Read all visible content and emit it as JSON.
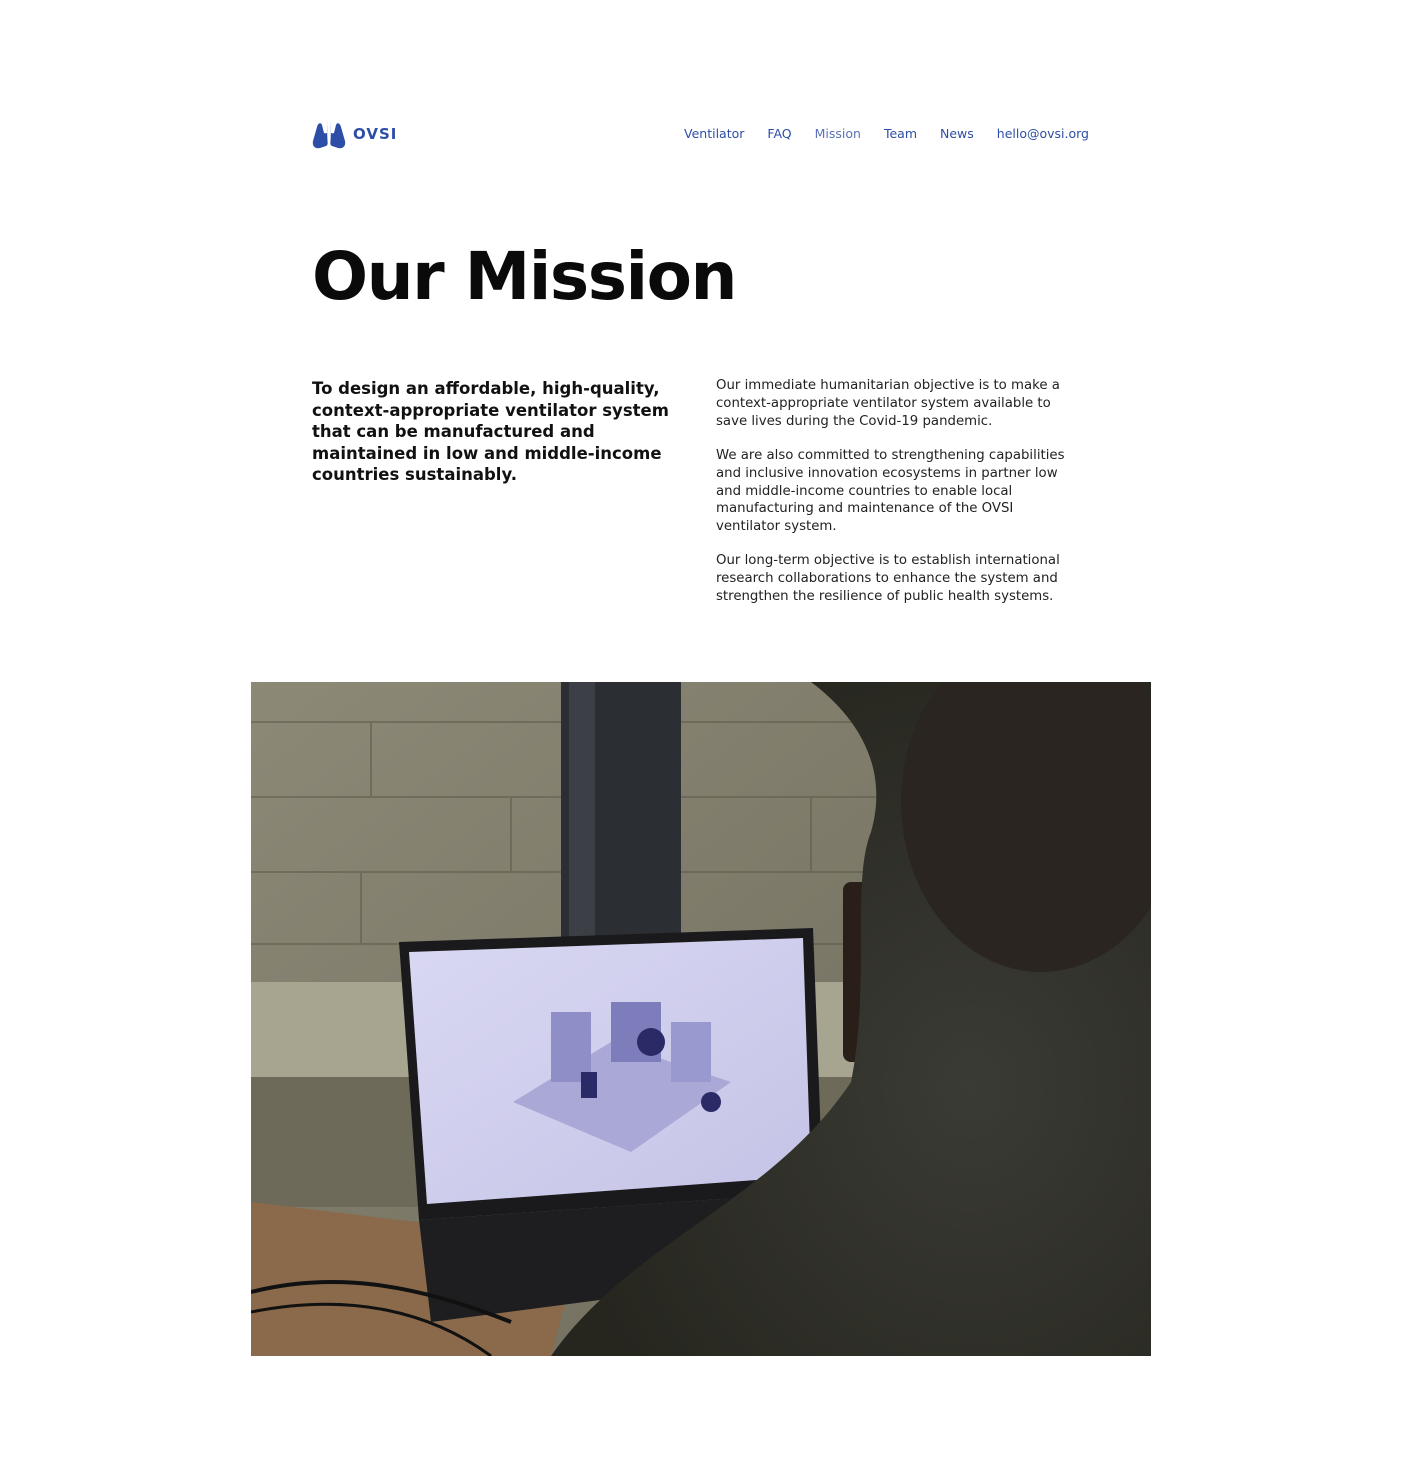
{
  "brand": {
    "name": "OVSI",
    "logo_icon": "lungs-icon",
    "color": "#2d4ea6"
  },
  "nav": {
    "items": [
      {
        "label": "Ventilator",
        "active": false
      },
      {
        "label": "FAQ",
        "active": false
      },
      {
        "label": "Mission",
        "active": true
      },
      {
        "label": "Team",
        "active": false
      },
      {
        "label": "News",
        "active": false
      },
      {
        "label": "hello@ovsi.org",
        "active": false
      }
    ]
  },
  "main": {
    "title": "Our Mission",
    "lead_lines": [
      "To design an affordable, high-quality,",
      "context-appropriate ventilator system",
      "that can be manufactured and",
      "maintained in low and middle-income",
      "countries sustainably."
    ],
    "paragraphs": [
      [
        "Our immediate humanitarian objective is to make a",
        "context-appropriate ventilator system available to",
        "save lives during the Covid-19 pandemic."
      ],
      [
        "We are also committed to strengthening capabilities",
        "and inclusive innovation ecosystems in partner low",
        "and middle-income countries to enable local",
        "manufacturing and maintenance of the OVSI",
        "ventilator system."
      ],
      [
        "Our long-term objective is to establish international",
        "research collaborations to enhance the system and",
        "strengthen the resilience of public health systems."
      ]
    ]
  },
  "photo": {
    "subject": "person-viewing-cad-ventilator-model-on-laptop"
  }
}
